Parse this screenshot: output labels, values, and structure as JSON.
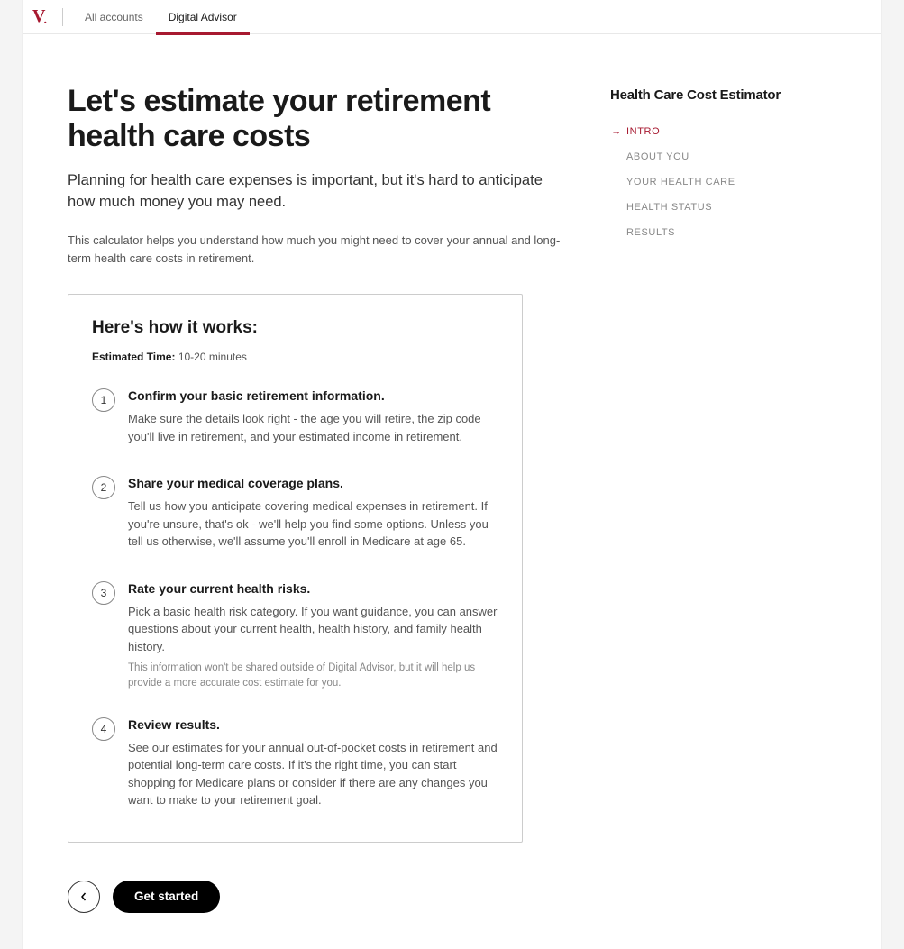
{
  "nav": {
    "logo_letter": "V",
    "links": [
      {
        "label": "All accounts",
        "active": false
      },
      {
        "label": "Digital Advisor",
        "active": true
      }
    ]
  },
  "main": {
    "title": "Let's estimate your retirement health care costs",
    "lead": "Planning for health care expenses is important, but it's hard to anticipate how much money you may need.",
    "subtext": "This calculator helps you understand how much you might need to cover your annual and long-term health care costs in retirement."
  },
  "card": {
    "title": "Here's how it works:",
    "est_label": "Estimated Time:",
    "est_value": "10-20 minutes",
    "steps": [
      {
        "num": "1",
        "title": "Confirm your basic retirement information.",
        "desc": "Make sure the details look right - the age you will retire, the zip code you'll live in retirement, and your estimated income in retirement.",
        "note": ""
      },
      {
        "num": "2",
        "title": "Share your medical coverage plans.",
        "desc": "Tell us how you anticipate covering medical expenses in retirement. If you're unsure, that's ok - we'll help you find some options. Unless you tell us otherwise, we'll assume you'll enroll in Medicare at age 65.",
        "note": ""
      },
      {
        "num": "3",
        "title": "Rate your current health risks.",
        "desc": "Pick a basic health risk category. If you want guidance, you can answer questions about your current health, health history, and family health history.",
        "note": "This information won't be shared outside of Digital Advisor, but it will help us provide a more accurate cost estimate for you."
      },
      {
        "num": "4",
        "title": "Review results.",
        "desc": "See our estimates for your annual out-of-pocket costs in retirement and potential long-term care costs. If it's the right time, you can start shopping for Medicare plans or consider if there are any changes you want to make to your retirement goal.",
        "note": ""
      }
    ]
  },
  "actions": {
    "primary": "Get started"
  },
  "sidebar": {
    "title": "Health Care Cost Estimator",
    "items": [
      {
        "label": "INTRO",
        "active": true
      },
      {
        "label": "ABOUT YOU",
        "active": false
      },
      {
        "label": "YOUR HEALTH CARE",
        "active": false
      },
      {
        "label": "HEALTH STATUS",
        "active": false
      },
      {
        "label": "RESULTS",
        "active": false
      }
    ]
  }
}
